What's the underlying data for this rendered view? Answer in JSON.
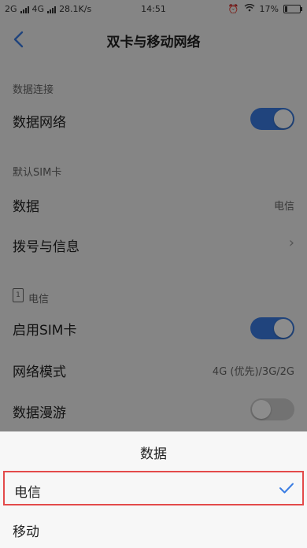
{
  "status_bar": {
    "sim1": "2G",
    "sim2": "4G",
    "speed": "28.1K/s",
    "time": "14:51",
    "battery": "17%"
  },
  "nav": {
    "title": "双卡与移动网络"
  },
  "sections": {
    "data_connection": {
      "header": "数据连接",
      "data_network_label": "数据网络",
      "data_network_on": true
    },
    "default_sim": {
      "header": "默认SIM卡",
      "data_label": "数据",
      "data_value": "电信",
      "dial_label": "拨号与信息"
    },
    "telecom": {
      "header_num": "1",
      "header": "电信",
      "enable_label": "启用SIM卡",
      "enable_on": true,
      "network_mode_label": "网络模式",
      "network_mode_value": "4G (优先)/3G/2G",
      "roaming_label": "数据漫游",
      "roaming_on": false
    }
  },
  "sheet": {
    "title": "数据",
    "options": [
      {
        "label": "电信",
        "selected": true
      },
      {
        "label": "移动",
        "selected": false
      }
    ]
  },
  "colors": {
    "accent": "#3b7de3",
    "highlight_border": "#e34a4a"
  }
}
